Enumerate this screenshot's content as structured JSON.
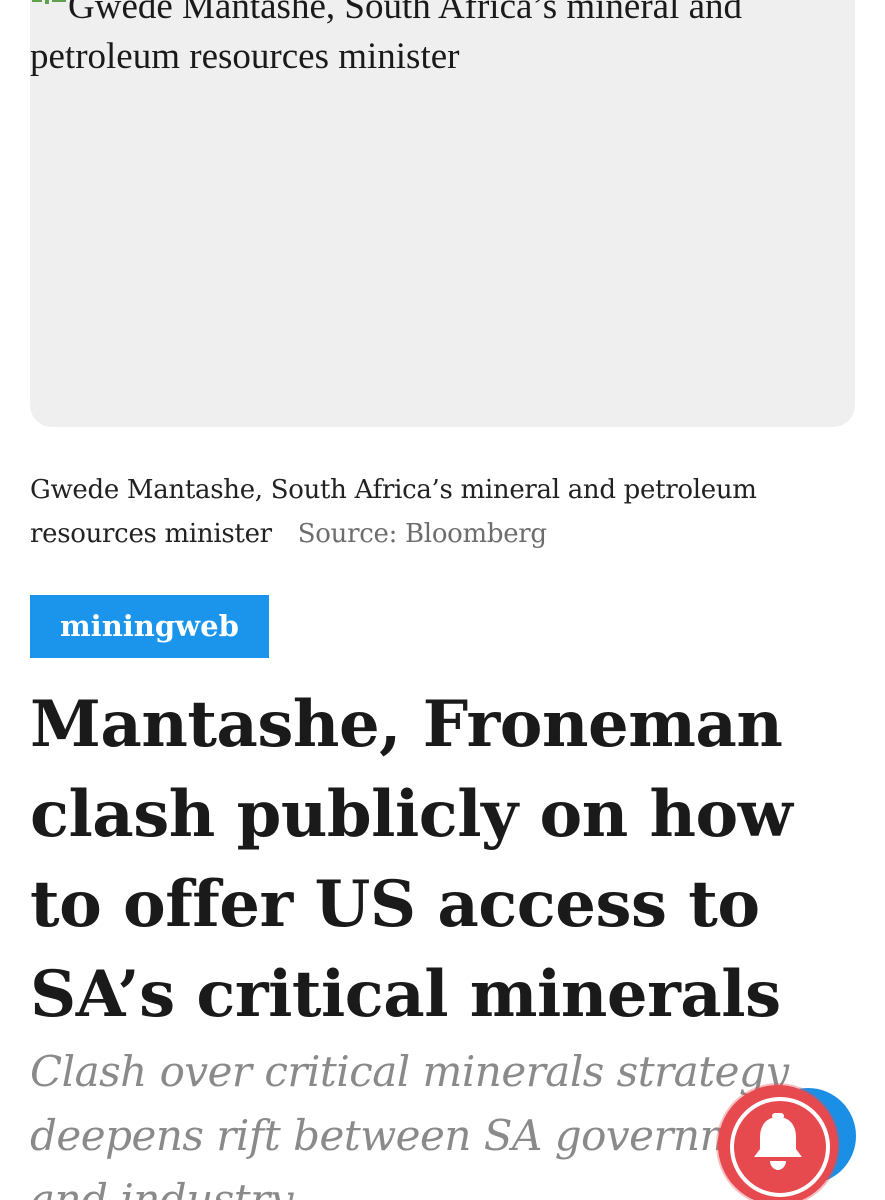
{
  "image": {
    "alt_text": "Gwede Mantashe, South Africa’s mineral and petroleum resources minister"
  },
  "caption": {
    "text": "Gwede Mantashe, South Africa’s mineral and petroleum resources minister",
    "source": "Source: Bloomberg"
  },
  "tag": {
    "label": "miningweb"
  },
  "article": {
    "headline": "Mantashe, Froneman clash publicly on how to offer US access to SA’s critical minerals",
    "subtitle": "Clash over critical minerals strategy deepens rift between SA government and industry"
  },
  "colors": {
    "tag_background": "#1b95eb",
    "notification_button": "#e64a4f",
    "secondary_button": "#1b8fe6",
    "image_placeholder": "#efefef"
  },
  "icons": {
    "broken_image": "broken-image-icon",
    "notification": "bell-icon"
  }
}
